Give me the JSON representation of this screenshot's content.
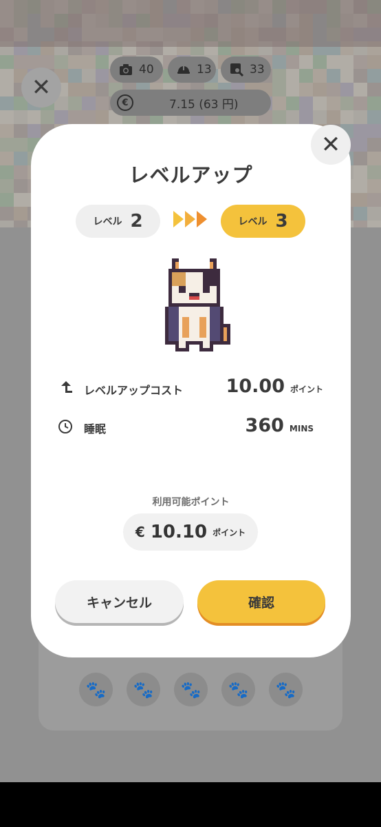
{
  "header": {
    "stats": [
      {
        "icon": "camera-icon",
        "value": "40"
      },
      {
        "icon": "helmet-icon",
        "value": "13"
      },
      {
        "icon": "photo-search-icon",
        "value": "33"
      }
    ],
    "balance": {
      "icon": "coin-icon",
      "text": "7.15 (63 円)"
    }
  },
  "modal": {
    "title": "レベルアップ",
    "from_level": {
      "label": "レベル",
      "value": "2"
    },
    "to_level": {
      "label": "レベル",
      "value": "3"
    },
    "rows": [
      {
        "icon": "arrow-up-icon",
        "label": "レベルアップコスト",
        "value": "10.00",
        "unit": "ポイント"
      },
      {
        "icon": "clock-icon",
        "label": "睡眠",
        "value": "360",
        "unit": "MINS"
      }
    ],
    "available": {
      "label": "利用可能ポイント",
      "symbol": "€",
      "value": "10.10",
      "unit": "ポイント"
    },
    "buttons": {
      "cancel": "キャンセル",
      "confirm": "確認"
    }
  },
  "colors": {
    "accent": "#f4c23c",
    "accent_shadow": "#e38d24",
    "text": "#3a3a3a"
  }
}
